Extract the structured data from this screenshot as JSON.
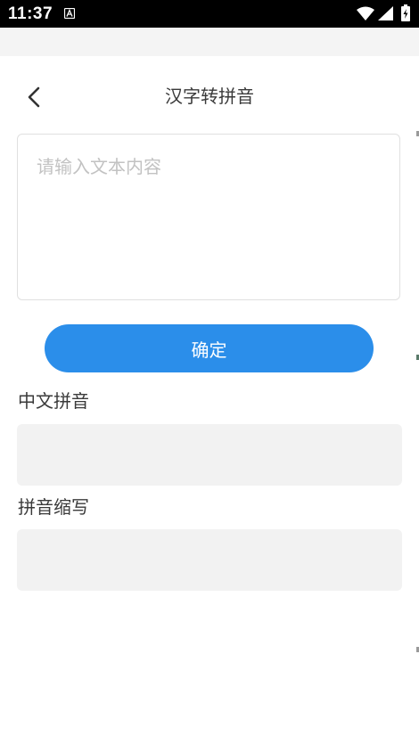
{
  "status_bar": {
    "time": "11:37",
    "app_icon": "a-letter-icon",
    "wifi_icon": "wifi-icon",
    "signal_icon": "signal-icon",
    "battery_icon": "battery-charging-icon"
  },
  "header": {
    "title": "汉字转拼音",
    "back_icon": "chevron-left-icon"
  },
  "input": {
    "placeholder": "请输入文本内容",
    "value": ""
  },
  "confirm_button": {
    "label": "确定"
  },
  "pinyin_section": {
    "label": "中文拼音",
    "value": ""
  },
  "abbr_section": {
    "label": "拼音缩写",
    "value": ""
  },
  "colors": {
    "accent": "#2b8eea",
    "status_bar": "#000000",
    "result_background": "#f2f2f2",
    "placeholder": "#c2c2c2",
    "text": "#3a3a3a"
  }
}
